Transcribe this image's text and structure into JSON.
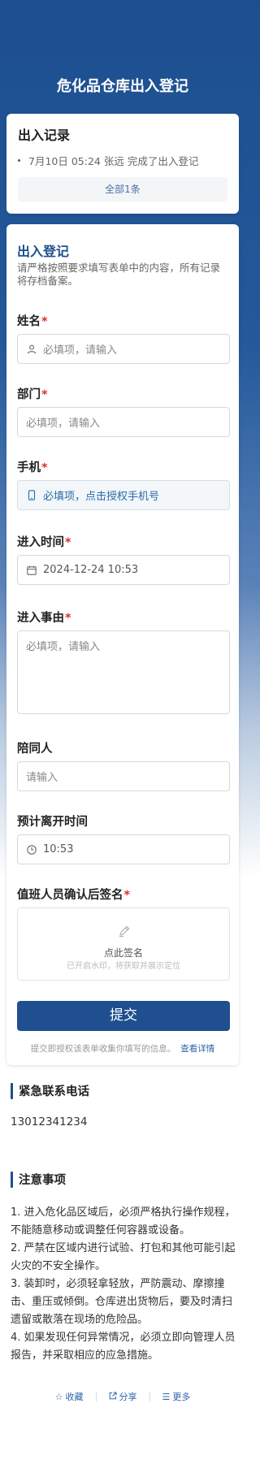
{
  "page": {
    "title": "危化品仓库出入登记"
  },
  "records": {
    "title": "出入记录",
    "items": [
      {
        "time": "7月10日 05:24",
        "name": "张远",
        "action": "完成了出入登记"
      }
    ],
    "all_label": "全部1条"
  },
  "form": {
    "title": "出入登记",
    "desc": "请严格按照要求填写表单中的内容，所有记录将存档备案。",
    "name": {
      "label": "姓名",
      "required": "*",
      "placeholder": "必填项，请输入",
      "icon": "person-icon"
    },
    "dept": {
      "label": "部门",
      "required": "*",
      "placeholder": "必填项，请输入"
    },
    "phone": {
      "label": "手机",
      "required": "*",
      "placeholder": "必填项，点击授权手机号",
      "icon": "mobile-icon"
    },
    "entry_time": {
      "label": "进入时间",
      "required": "*",
      "value": "2024-12-24 10:53",
      "icon": "calendar-icon"
    },
    "reason": {
      "label": "进入事由",
      "required": "*",
      "placeholder": "必填项，请输入"
    },
    "companion": {
      "label": "陪同人",
      "placeholder": "请输入"
    },
    "leave_time": {
      "label": "预计离开时间",
      "value": "10:53",
      "icon": "clock-icon"
    },
    "signature": {
      "label": "值班人员确认后签名",
      "required": "*",
      "main": "点此签名",
      "sub": "已开启水印，将获取并展示定位",
      "icon": "pen-icon"
    },
    "submit_label": "提交",
    "consent": "提交即授权该表单收集你填写的信息。",
    "consent_link": "查看详情"
  },
  "emergency": {
    "title": "紧急联系电话",
    "phone": "13012341234"
  },
  "notes": {
    "title": "注意事项",
    "items": [
      "1. 进入危化品区域后，必须严格执行操作规程，不能随意移动或调整任何容器或设备。",
      "2. 严禁在区域内进行试验、打包和其他可能引起火灾的不安全操作。",
      "3. 装卸时，必须轻拿轻放，严防震动、摩擦撞击、重压或倾倒。仓库进出货物后，要及时清扫遗留或散落在现场的危险品。",
      "4. 如果发现任何异常情况，必须立即向管理人员报告，并采取相应的应急措施。"
    ]
  },
  "bottom": {
    "favorite": "收藏",
    "share": "分享",
    "more": "更多"
  },
  "colors": {
    "primary": "#1f4f8e",
    "required": "#d9302c",
    "link": "#2d64a8"
  }
}
